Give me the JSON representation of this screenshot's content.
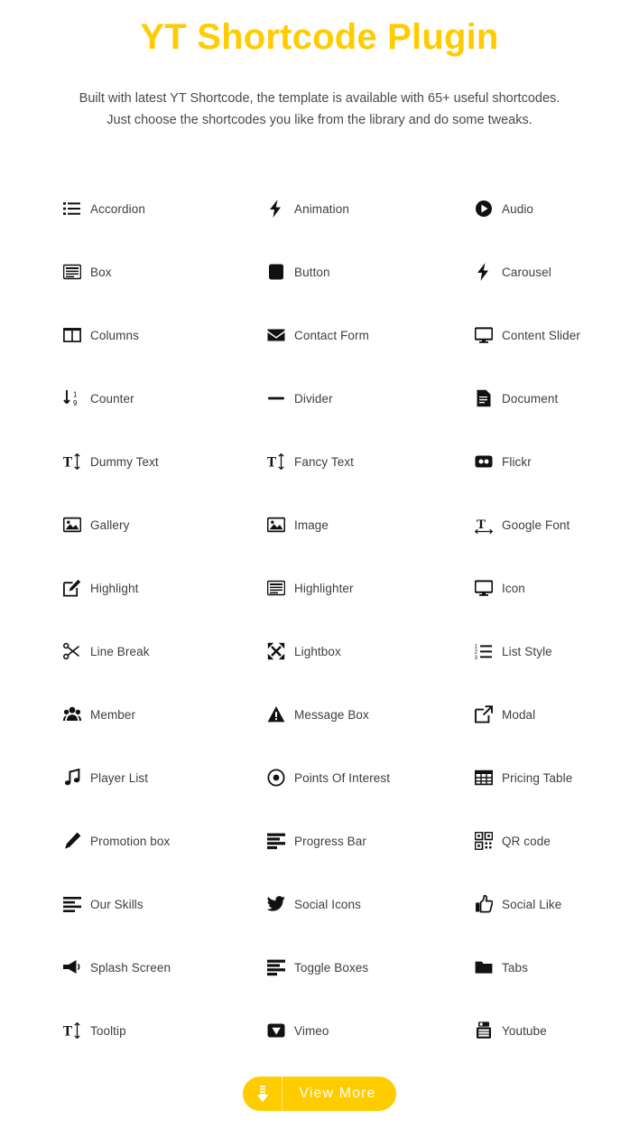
{
  "hero": {
    "title": "YT Shortcode Plugin",
    "subtitle_line1": "Built with latest YT Shortcode, the template is available with 65+ useful shortcodes.",
    "subtitle_line2": "Just choose the shortcodes you like from the library and do some tweaks.",
    "title_color": "#ffcc00",
    "subtitle_color": "#4a4a4a"
  },
  "grid": {
    "columns": 3,
    "rows": 14,
    "items": [
      {
        "label": "Accordion",
        "icon": "list-icon"
      },
      {
        "label": "Animation",
        "icon": "bolt-icon"
      },
      {
        "label": "Audio",
        "icon": "play-circle-icon"
      },
      {
        "label": "Box",
        "icon": "window-box-icon"
      },
      {
        "label": "Button",
        "icon": "square-filled-icon"
      },
      {
        "label": "Carousel",
        "icon": "bolt-icon"
      },
      {
        "label": "Columns",
        "icon": "columns-icon"
      },
      {
        "label": "Contact Form",
        "icon": "envelope-icon"
      },
      {
        "label": "Content Slider",
        "icon": "desktop-icon"
      },
      {
        "label": "Counter",
        "icon": "sort-numeric-icon"
      },
      {
        "label": "Divider",
        "icon": "minus-icon"
      },
      {
        "label": "Document",
        "icon": "file-text-icon"
      },
      {
        "label": "Dummy Text",
        "icon": "text-height-icon"
      },
      {
        "label": "Fancy Text",
        "icon": "text-height-icon"
      },
      {
        "label": "Flickr",
        "icon": "flickr-icon"
      },
      {
        "label": "Gallery",
        "icon": "image-icon"
      },
      {
        "label": "Image",
        "icon": "image-icon"
      },
      {
        "label": "Google Font",
        "icon": "text-width-icon"
      },
      {
        "label": "Highlight",
        "icon": "pencil-square-icon"
      },
      {
        "label": "Highlighter",
        "icon": "window-box-icon"
      },
      {
        "label": "Icon",
        "icon": "desktop-icon"
      },
      {
        "label": "Line Break",
        "icon": "scissors-icon"
      },
      {
        "label": "Lightbox",
        "icon": "expand-arrows-icon"
      },
      {
        "label": "List Style",
        "icon": "ordered-list-icon"
      },
      {
        "label": "Member",
        "icon": "users-icon"
      },
      {
        "label": "Message Box",
        "icon": "warning-triangle-icon"
      },
      {
        "label": "Modal",
        "icon": "external-link-icon"
      },
      {
        "label": "Player List",
        "icon": "music-note-icon"
      },
      {
        "label": "Points Of Interest",
        "icon": "dot-circle-icon"
      },
      {
        "label": "Pricing Table",
        "icon": "table-grid-icon"
      },
      {
        "label": "Promotion box",
        "icon": "pencil-icon"
      },
      {
        "label": "Progress Bar",
        "icon": "progress-bars-icon"
      },
      {
        "label": "QR code",
        "icon": "qrcode-icon"
      },
      {
        "label": "Our Skills",
        "icon": "align-left-icon"
      },
      {
        "label": "Social Icons",
        "icon": "twitter-bird-icon"
      },
      {
        "label": "Social Like",
        "icon": "thumbs-up-icon"
      },
      {
        "label": "Splash Screen",
        "icon": "bullhorn-icon"
      },
      {
        "label": "Toggle Boxes",
        "icon": "progress-bars-icon"
      },
      {
        "label": "Tabs",
        "icon": "folder-icon"
      },
      {
        "label": "Tooltip",
        "icon": "text-height-icon"
      },
      {
        "label": "Vimeo",
        "icon": "vimeo-icon"
      },
      {
        "label": "Youtube",
        "icon": "youtube-icon"
      }
    ]
  },
  "footer": {
    "view_more_label": "View More",
    "view_more_icon": "download-arrow-icon",
    "button_color": "#ffcc00",
    "button_text_color": "#ffffff"
  }
}
